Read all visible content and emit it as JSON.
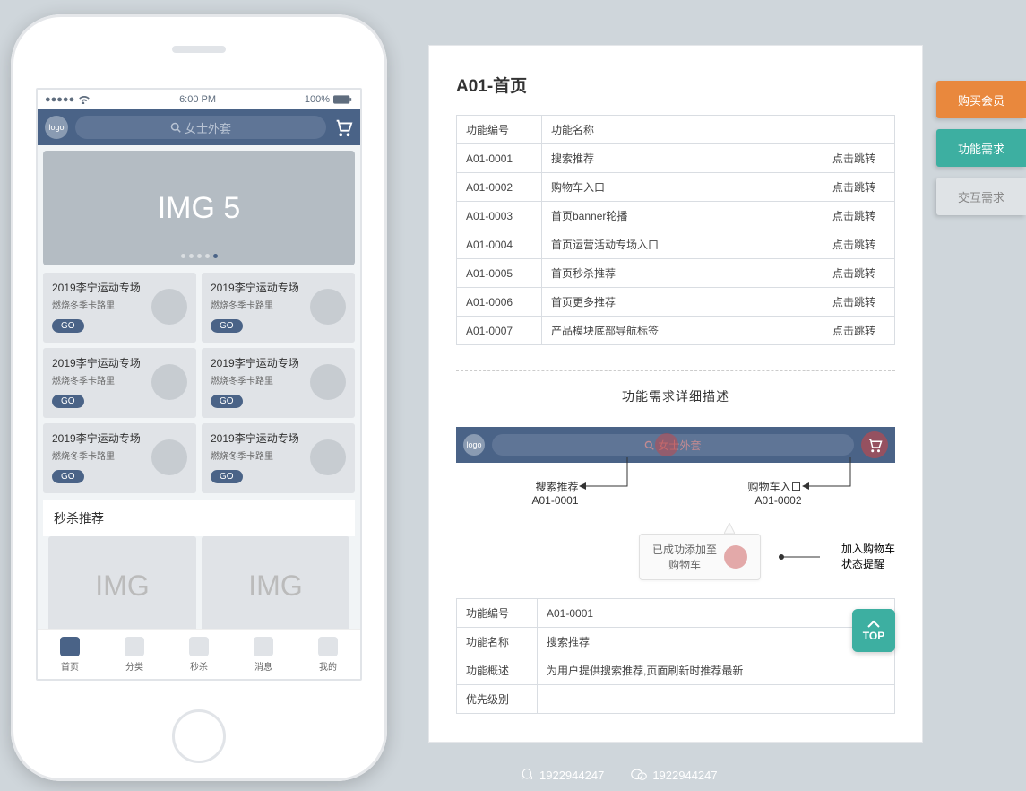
{
  "phone": {
    "status": {
      "time": "6:00 PM",
      "battery": "100%"
    },
    "logo": "logo",
    "search_placeholder": "女士外套",
    "banner_label": "IMG 5",
    "promo": {
      "title": "2019李宁运动专场",
      "sub": "燃烧冬季卡路里",
      "go": "GO"
    },
    "section_flash": "秒杀推荐",
    "flash_img": "IMG",
    "tabs": [
      "首页",
      "分类",
      "秒杀",
      "消息",
      "我的"
    ]
  },
  "doc": {
    "title": "A01-首页",
    "table": {
      "headers": [
        "功能编号",
        "功能名称",
        ""
      ],
      "rows": [
        [
          "A01-0001",
          "搜索推荐",
          "点击跳转"
        ],
        [
          "A01-0002",
          "购物车入口",
          "点击跳转"
        ],
        [
          "A01-0003",
          "首页banner轮播",
          "点击跳转"
        ],
        [
          "A01-0004",
          "首页运营活动专场入口",
          "点击跳转"
        ],
        [
          "A01-0005",
          "首页秒杀推荐",
          "点击跳转"
        ],
        [
          "A01-0006",
          "首页更多推荐",
          "点击跳转"
        ],
        [
          "A01-0007",
          "产品模块底部导航标签",
          "点击跳转"
        ]
      ]
    },
    "detail_title": "功能需求详细描述",
    "mini_logo": "logo",
    "mini_search": "女士外套",
    "anno": {
      "search_label": "搜索推荐",
      "search_id": "A01-0001",
      "cart_label": "购物车入口",
      "cart_id": "A01-0002",
      "popup_text_1": "已成功添加至",
      "popup_text_2": "购物车",
      "popup_label_1": "加入购物车",
      "popup_label_2": "状态提醒"
    },
    "detail_table": {
      "rows": [
        [
          "功能编号",
          "A01-0001"
        ],
        [
          "功能名称",
          "搜索推荐"
        ],
        [
          "功能概述",
          "为用户提供搜索推荐,页面刷新时推荐最新"
        ],
        [
          "优先级别",
          ""
        ]
      ]
    }
  },
  "side_tabs": {
    "buy": "购买会员",
    "func": "功能需求",
    "inter": "交互需求"
  },
  "top_btn": "TOP",
  "footer": {
    "qq": "1922944247",
    "wechat": "1922944247"
  }
}
